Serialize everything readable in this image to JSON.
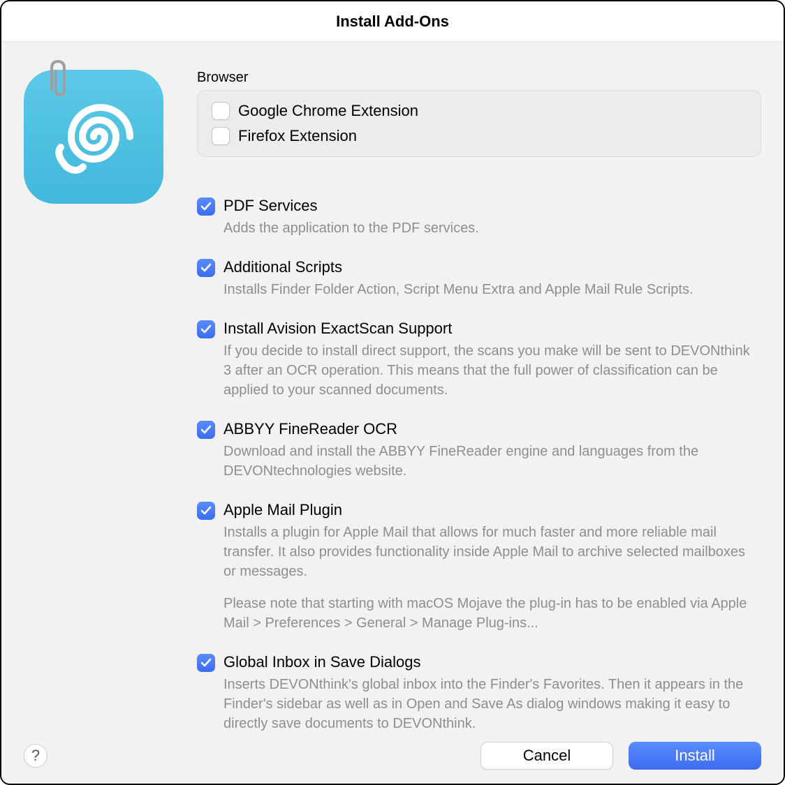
{
  "title": "Install Add-Ons",
  "browser": {
    "label": "Browser",
    "items": [
      {
        "label": "Google Chrome Extension",
        "checked": false
      },
      {
        "label": "Firefox Extension",
        "checked": false
      }
    ]
  },
  "options": [
    {
      "id": "pdf-services",
      "label": "PDF Services",
      "checked": true,
      "desc": "Adds the application to the PDF services."
    },
    {
      "id": "additional-scripts",
      "label": "Additional Scripts",
      "checked": true,
      "desc": "Installs Finder Folder Action, Script Menu Extra and Apple Mail Rule Scripts."
    },
    {
      "id": "avision-exactscan",
      "label": "Install Avision ExactScan Support",
      "checked": true,
      "desc": "If you decide to install direct support, the scans you make will be sent to DEVONthink 3 after an OCR operation. This means that the full power of classification can be applied to your scanned documents."
    },
    {
      "id": "abbyy-finereader",
      "label": "ABBYY FineReader OCR",
      "checked": true,
      "desc": "Download and install the ABBYY FineReader engine and languages from the DEVONtechnologies website."
    },
    {
      "id": "apple-mail-plugin",
      "label": "Apple Mail Plugin",
      "checked": true,
      "desc": "Installs a plugin for Apple Mail that allows for much faster and more reliable mail transfer. It also provides functionality inside Apple Mail to archive selected mailboxes or messages.",
      "desc_extra": "Please note that starting with macOS Mojave the plug-in has to be enabled via Apple Mail > Preferences > General > Manage Plug-ins..."
    },
    {
      "id": "global-inbox",
      "label": "Global Inbox in Save Dialogs",
      "checked": true,
      "desc": "Inserts DEVONthink's global inbox into the Finder's Favorites. Then it appears in the Finder's sidebar as well as in Open and Save As dialog windows making it easy to directly save documents to DEVONthink."
    }
  ],
  "buttons": {
    "help": "?",
    "cancel": "Cancel",
    "install": "Install"
  }
}
